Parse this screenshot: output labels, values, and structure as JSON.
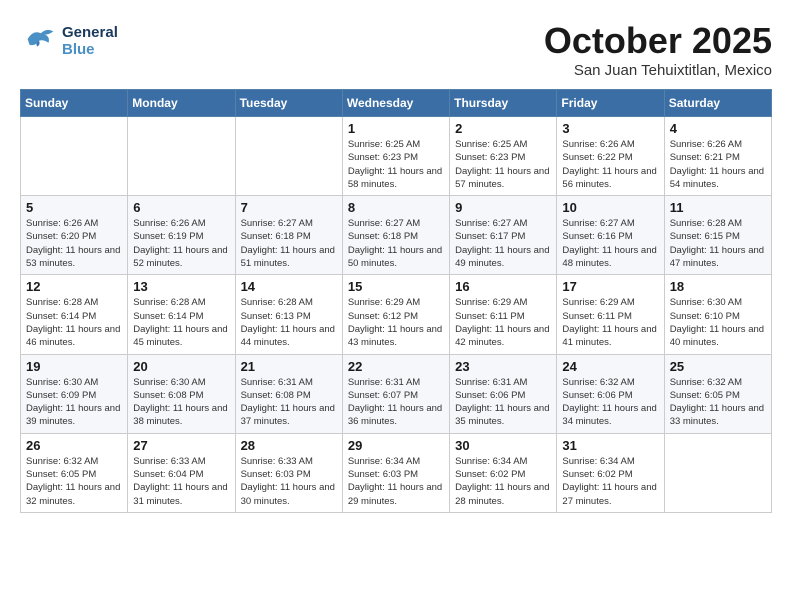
{
  "header": {
    "logo_general": "General",
    "logo_blue": "Blue",
    "month_title": "October 2025",
    "subtitle": "San Juan Tehuixtitlan, Mexico"
  },
  "weekdays": [
    "Sunday",
    "Monday",
    "Tuesday",
    "Wednesday",
    "Thursday",
    "Friday",
    "Saturday"
  ],
  "weeks": [
    [
      {
        "day": "",
        "sunrise": "",
        "sunset": "",
        "daylight": ""
      },
      {
        "day": "",
        "sunrise": "",
        "sunset": "",
        "daylight": ""
      },
      {
        "day": "",
        "sunrise": "",
        "sunset": "",
        "daylight": ""
      },
      {
        "day": "1",
        "sunrise": "Sunrise: 6:25 AM",
        "sunset": "Sunset: 6:23 PM",
        "daylight": "Daylight: 11 hours and 58 minutes."
      },
      {
        "day": "2",
        "sunrise": "Sunrise: 6:25 AM",
        "sunset": "Sunset: 6:23 PM",
        "daylight": "Daylight: 11 hours and 57 minutes."
      },
      {
        "day": "3",
        "sunrise": "Sunrise: 6:26 AM",
        "sunset": "Sunset: 6:22 PM",
        "daylight": "Daylight: 11 hours and 56 minutes."
      },
      {
        "day": "4",
        "sunrise": "Sunrise: 6:26 AM",
        "sunset": "Sunset: 6:21 PM",
        "daylight": "Daylight: 11 hours and 54 minutes."
      }
    ],
    [
      {
        "day": "5",
        "sunrise": "Sunrise: 6:26 AM",
        "sunset": "Sunset: 6:20 PM",
        "daylight": "Daylight: 11 hours and 53 minutes."
      },
      {
        "day": "6",
        "sunrise": "Sunrise: 6:26 AM",
        "sunset": "Sunset: 6:19 PM",
        "daylight": "Daylight: 11 hours and 52 minutes."
      },
      {
        "day": "7",
        "sunrise": "Sunrise: 6:27 AM",
        "sunset": "Sunset: 6:18 PM",
        "daylight": "Daylight: 11 hours and 51 minutes."
      },
      {
        "day": "8",
        "sunrise": "Sunrise: 6:27 AM",
        "sunset": "Sunset: 6:18 PM",
        "daylight": "Daylight: 11 hours and 50 minutes."
      },
      {
        "day": "9",
        "sunrise": "Sunrise: 6:27 AM",
        "sunset": "Sunset: 6:17 PM",
        "daylight": "Daylight: 11 hours and 49 minutes."
      },
      {
        "day": "10",
        "sunrise": "Sunrise: 6:27 AM",
        "sunset": "Sunset: 6:16 PM",
        "daylight": "Daylight: 11 hours and 48 minutes."
      },
      {
        "day": "11",
        "sunrise": "Sunrise: 6:28 AM",
        "sunset": "Sunset: 6:15 PM",
        "daylight": "Daylight: 11 hours and 47 minutes."
      }
    ],
    [
      {
        "day": "12",
        "sunrise": "Sunrise: 6:28 AM",
        "sunset": "Sunset: 6:14 PM",
        "daylight": "Daylight: 11 hours and 46 minutes."
      },
      {
        "day": "13",
        "sunrise": "Sunrise: 6:28 AM",
        "sunset": "Sunset: 6:14 PM",
        "daylight": "Daylight: 11 hours and 45 minutes."
      },
      {
        "day": "14",
        "sunrise": "Sunrise: 6:28 AM",
        "sunset": "Sunset: 6:13 PM",
        "daylight": "Daylight: 11 hours and 44 minutes."
      },
      {
        "day": "15",
        "sunrise": "Sunrise: 6:29 AM",
        "sunset": "Sunset: 6:12 PM",
        "daylight": "Daylight: 11 hours and 43 minutes."
      },
      {
        "day": "16",
        "sunrise": "Sunrise: 6:29 AM",
        "sunset": "Sunset: 6:11 PM",
        "daylight": "Daylight: 11 hours and 42 minutes."
      },
      {
        "day": "17",
        "sunrise": "Sunrise: 6:29 AM",
        "sunset": "Sunset: 6:11 PM",
        "daylight": "Daylight: 11 hours and 41 minutes."
      },
      {
        "day": "18",
        "sunrise": "Sunrise: 6:30 AM",
        "sunset": "Sunset: 6:10 PM",
        "daylight": "Daylight: 11 hours and 40 minutes."
      }
    ],
    [
      {
        "day": "19",
        "sunrise": "Sunrise: 6:30 AM",
        "sunset": "Sunset: 6:09 PM",
        "daylight": "Daylight: 11 hours and 39 minutes."
      },
      {
        "day": "20",
        "sunrise": "Sunrise: 6:30 AM",
        "sunset": "Sunset: 6:08 PM",
        "daylight": "Daylight: 11 hours and 38 minutes."
      },
      {
        "day": "21",
        "sunrise": "Sunrise: 6:31 AM",
        "sunset": "Sunset: 6:08 PM",
        "daylight": "Daylight: 11 hours and 37 minutes."
      },
      {
        "day": "22",
        "sunrise": "Sunrise: 6:31 AM",
        "sunset": "Sunset: 6:07 PM",
        "daylight": "Daylight: 11 hours and 36 minutes."
      },
      {
        "day": "23",
        "sunrise": "Sunrise: 6:31 AM",
        "sunset": "Sunset: 6:06 PM",
        "daylight": "Daylight: 11 hours and 35 minutes."
      },
      {
        "day": "24",
        "sunrise": "Sunrise: 6:32 AM",
        "sunset": "Sunset: 6:06 PM",
        "daylight": "Daylight: 11 hours and 34 minutes."
      },
      {
        "day": "25",
        "sunrise": "Sunrise: 6:32 AM",
        "sunset": "Sunset: 6:05 PM",
        "daylight": "Daylight: 11 hours and 33 minutes."
      }
    ],
    [
      {
        "day": "26",
        "sunrise": "Sunrise: 6:32 AM",
        "sunset": "Sunset: 6:05 PM",
        "daylight": "Daylight: 11 hours and 32 minutes."
      },
      {
        "day": "27",
        "sunrise": "Sunrise: 6:33 AM",
        "sunset": "Sunset: 6:04 PM",
        "daylight": "Daylight: 11 hours and 31 minutes."
      },
      {
        "day": "28",
        "sunrise": "Sunrise: 6:33 AM",
        "sunset": "Sunset: 6:03 PM",
        "daylight": "Daylight: 11 hours and 30 minutes."
      },
      {
        "day": "29",
        "sunrise": "Sunrise: 6:34 AM",
        "sunset": "Sunset: 6:03 PM",
        "daylight": "Daylight: 11 hours and 29 minutes."
      },
      {
        "day": "30",
        "sunrise": "Sunrise: 6:34 AM",
        "sunset": "Sunset: 6:02 PM",
        "daylight": "Daylight: 11 hours and 28 minutes."
      },
      {
        "day": "31",
        "sunrise": "Sunrise: 6:34 AM",
        "sunset": "Sunset: 6:02 PM",
        "daylight": "Daylight: 11 hours and 27 minutes."
      },
      {
        "day": "",
        "sunrise": "",
        "sunset": "",
        "daylight": ""
      }
    ]
  ]
}
